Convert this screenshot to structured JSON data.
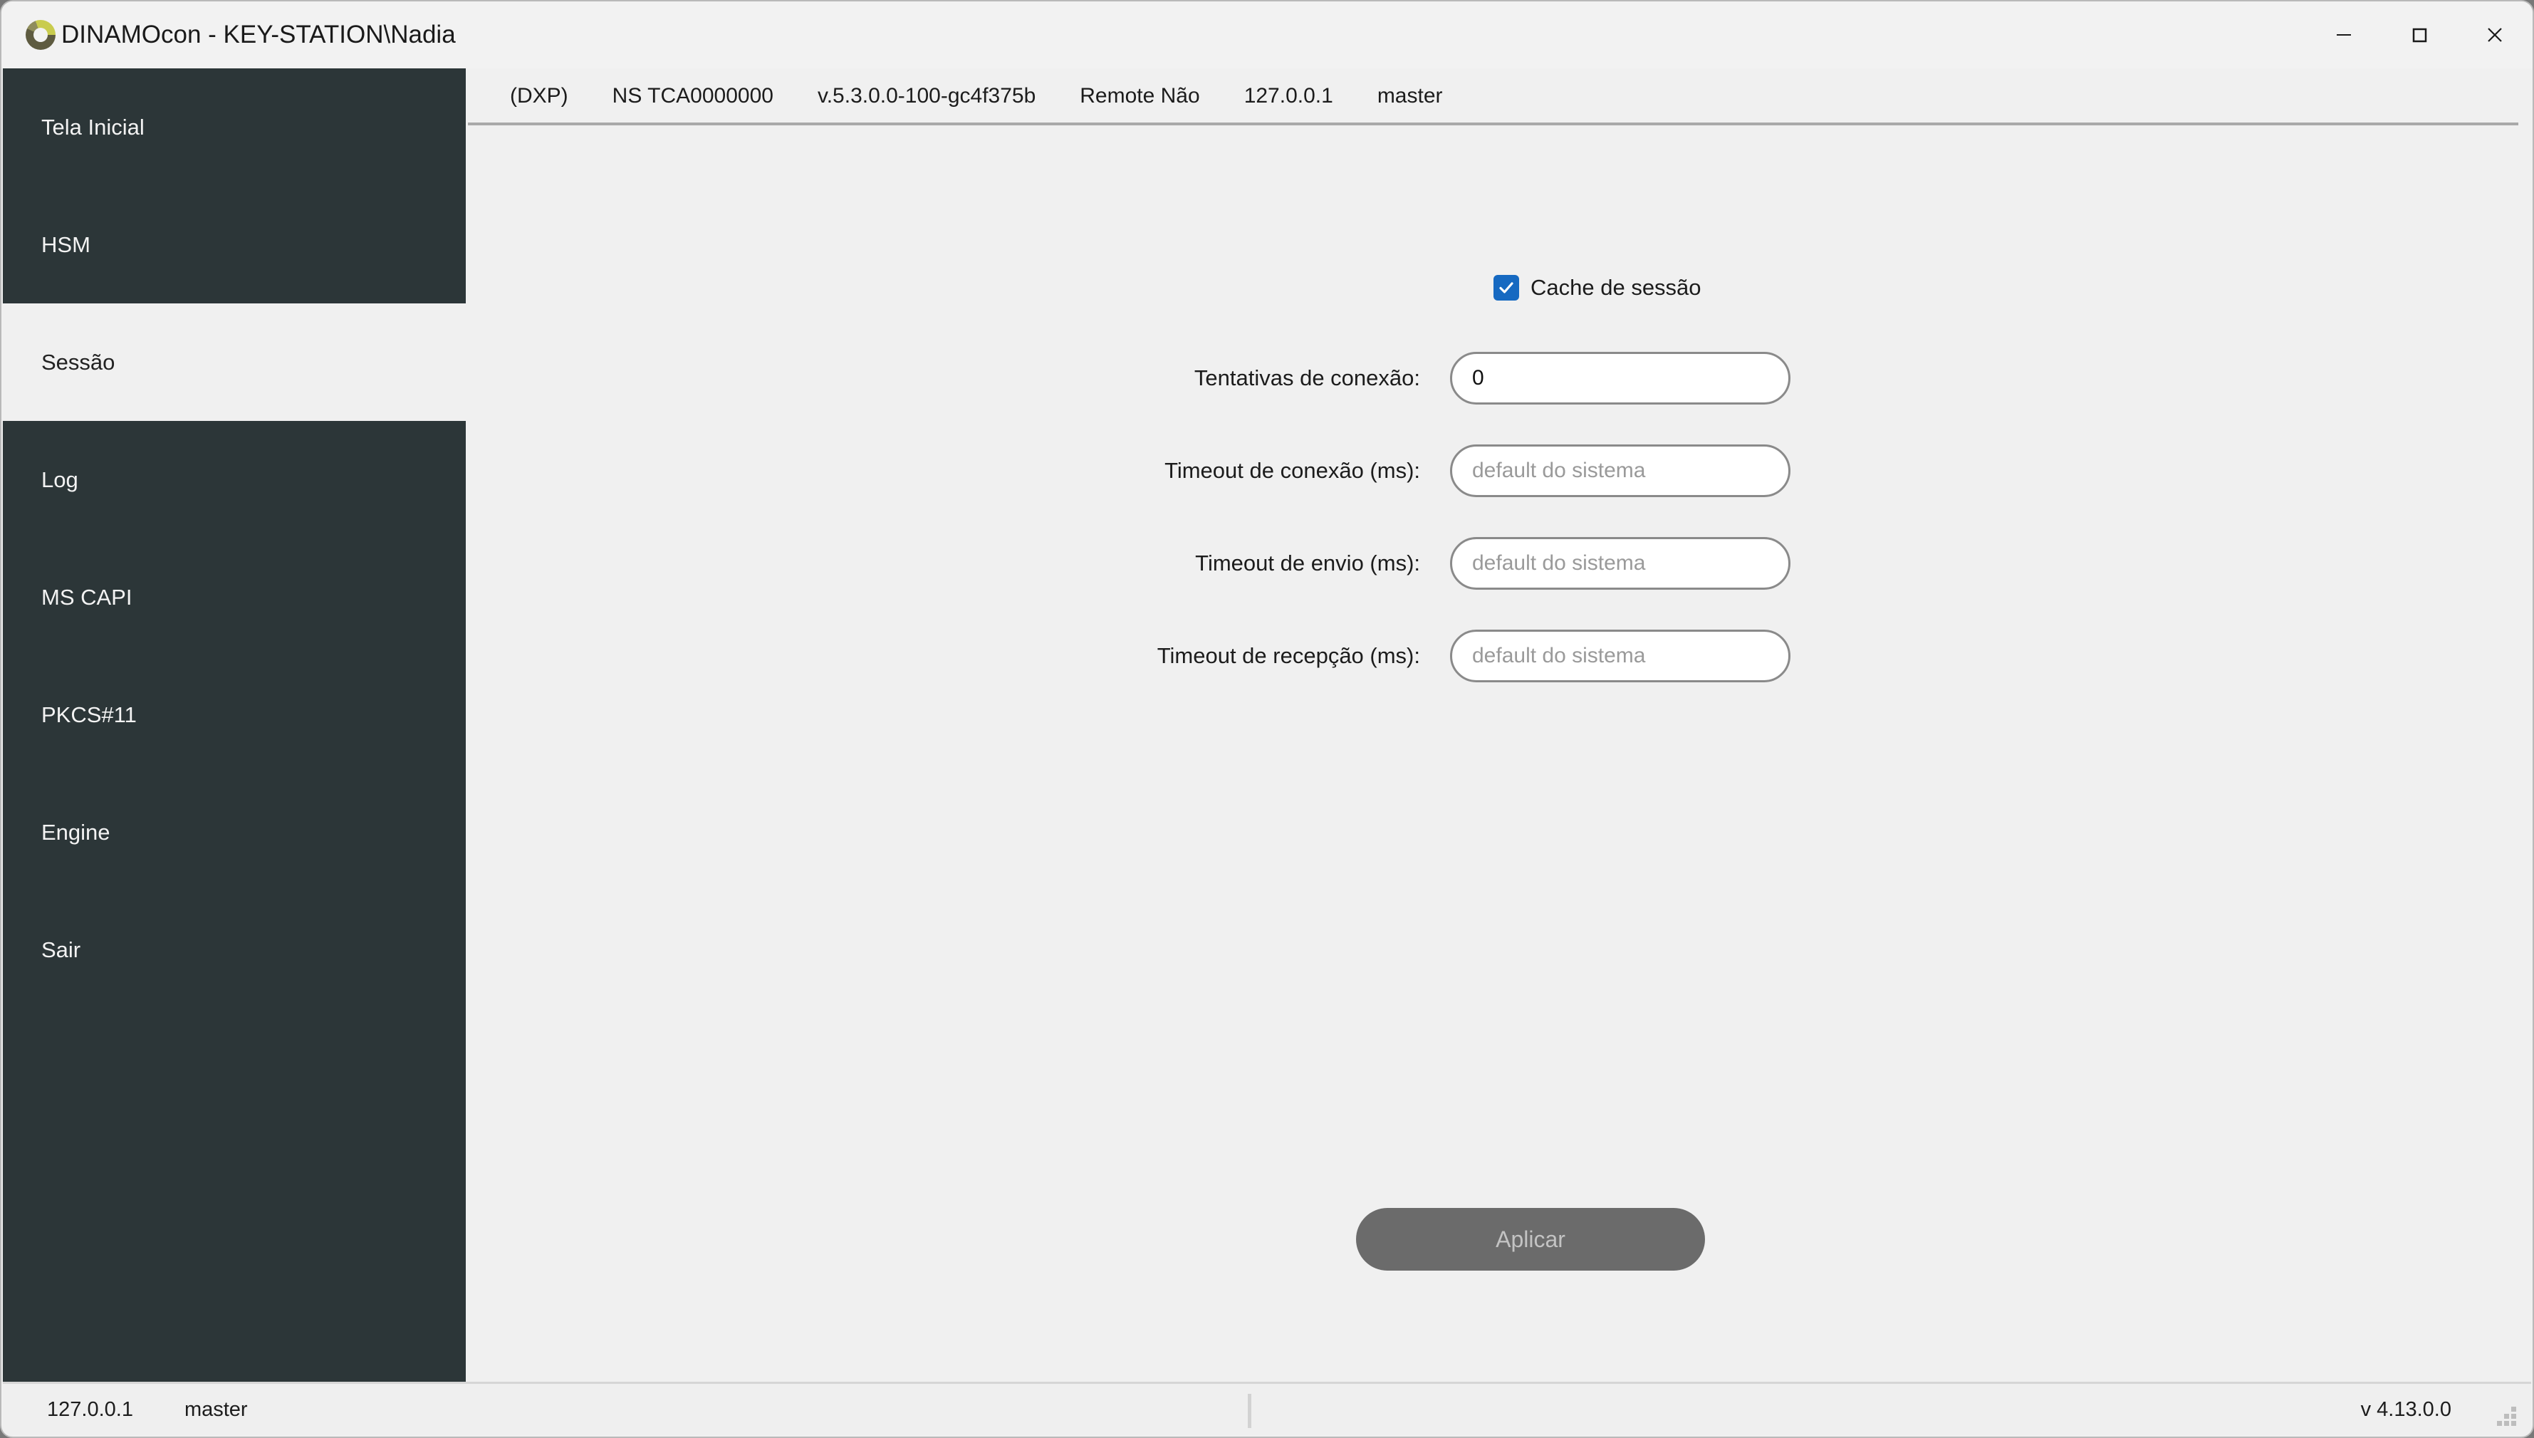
{
  "window": {
    "title": "DINAMOcon - KEY-STATION\\Nadia",
    "logo_icon": "ring-logo-icon",
    "controls": {
      "minimize": "minimize-icon",
      "maximize": "maximize-icon",
      "close": "close-icon"
    }
  },
  "sidebar": {
    "items": [
      {
        "label": "Tela Inicial",
        "selected": false
      },
      {
        "label": "HSM",
        "selected": false
      },
      {
        "label": "Sessão",
        "selected": true
      },
      {
        "label": "Log",
        "selected": false
      },
      {
        "label": "MS CAPI",
        "selected": false
      },
      {
        "label": "PKCS#11",
        "selected": false
      },
      {
        "label": "Engine",
        "selected": false
      },
      {
        "label": "Sair",
        "selected": false
      }
    ]
  },
  "infobar": {
    "mode": "(DXP)",
    "serial": "NS TCA0000000",
    "version": "v.5.3.0.0-100-gc4f375b",
    "remote": "Remote Não",
    "address": "127.0.0.1",
    "user": "master"
  },
  "main": {
    "cache_checkbox": {
      "label": "Cache de sessão",
      "checked": true,
      "accent_color": "#1669c1"
    },
    "fields": [
      {
        "label": "Tentativas de conexão:",
        "value": "0",
        "placeholder": ""
      },
      {
        "label": "Timeout de conexão (ms):",
        "value": "",
        "placeholder": "default do sistema"
      },
      {
        "label": "Timeout de envio (ms):",
        "value": "",
        "placeholder": "default do sistema"
      },
      {
        "label": "Timeout de recepção (ms):",
        "value": "",
        "placeholder": "default do sistema"
      }
    ],
    "apply_button": {
      "label": "Aplicar",
      "enabled": false,
      "color": "#6b6b6b"
    }
  },
  "statusbar": {
    "address": "127.0.0.1",
    "user": "master",
    "version": "v 4.13.0.0",
    "grip_icon": "resize-grip-icon"
  },
  "colors": {
    "sidebar_bg": "#2c3638",
    "content_bg": "#f0f0f0",
    "accent": "#1669c1"
  }
}
